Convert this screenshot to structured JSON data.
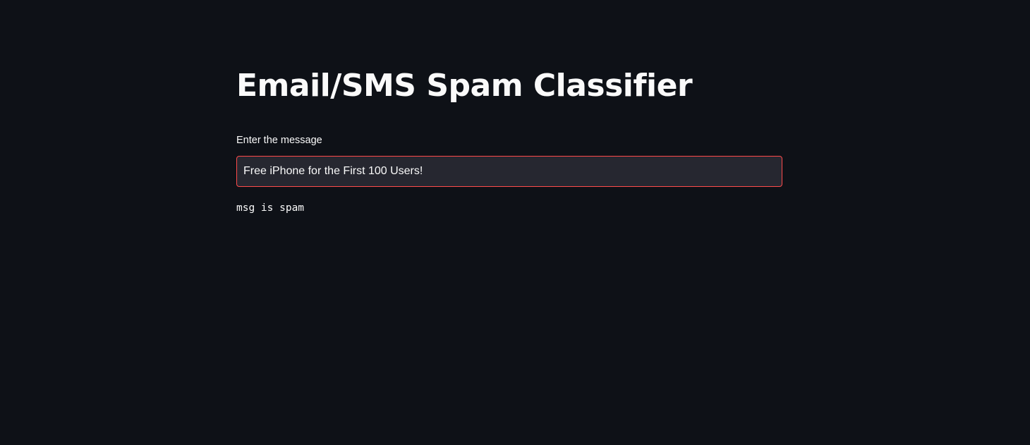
{
  "page": {
    "title": "Email/SMS Spam Classifier"
  },
  "form": {
    "message_label": "Enter the message",
    "message_value": "Free iPhone for the First 100 Users!"
  },
  "output": {
    "result_text": "msg is spam"
  },
  "theme": {
    "background": "#0e1117",
    "input_background": "#262730",
    "focus_border": "#ff4b4b",
    "text": "#fafafa"
  }
}
